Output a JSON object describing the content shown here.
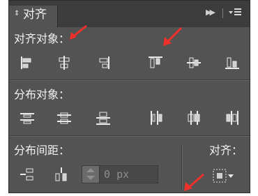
{
  "tab": {
    "title": "对齐"
  },
  "sections": {
    "align_objects": "对齐对象：",
    "distribute_objects": "分布对象：",
    "distribute_spacing": "分布间距：",
    "align_to": "对齐："
  },
  "spacing": {
    "value": "0",
    "unit": "px"
  },
  "colors": {
    "panel": "#535353",
    "tabbar": "#3c3c3c",
    "text": "#f2f2f2",
    "annotation_arrow": "#f0302a"
  }
}
